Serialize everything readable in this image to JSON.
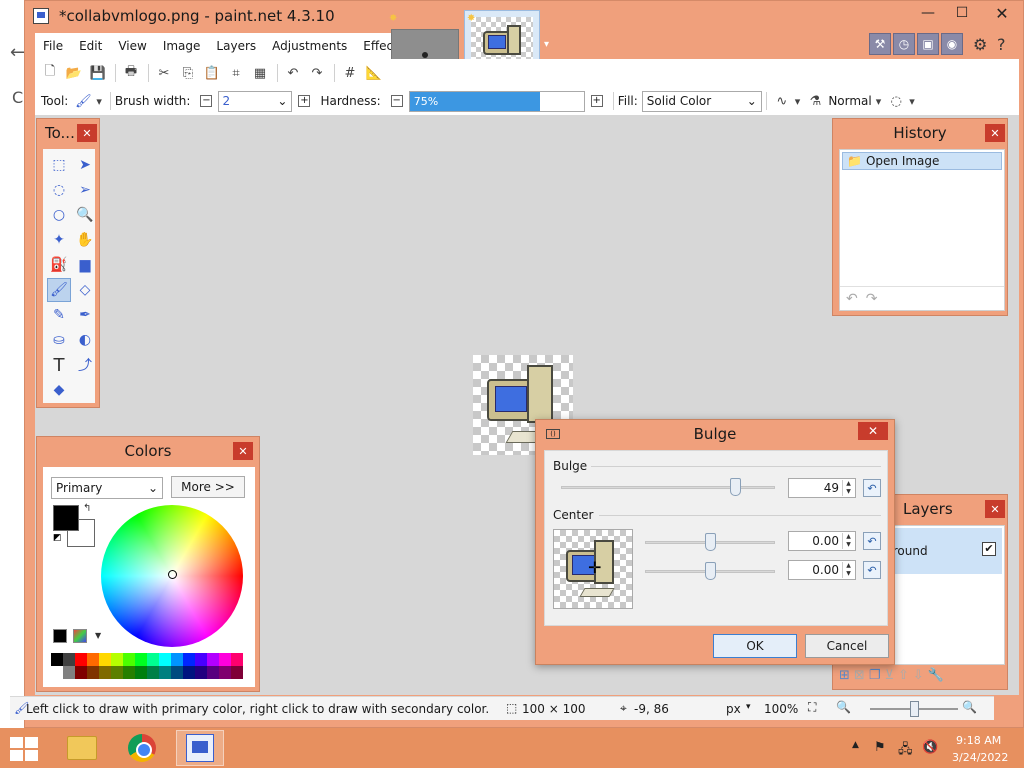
{
  "window": {
    "title": "*collabvmlogo.png - paint.net 4.3.10"
  },
  "menu": [
    "File",
    "Edit",
    "View",
    "Image",
    "Layers",
    "Adjustments",
    "Effects"
  ],
  "options": {
    "tool_label": "Tool:",
    "brush_width_label": "Brush width:",
    "brush_width_value": "2",
    "hardness_label": "Hardness:",
    "hardness_value": "75%",
    "hardness_fraction": 0.75,
    "fill_label": "Fill:",
    "fill_value": "Solid Color",
    "blend_mode": "Normal"
  },
  "tools_panel": {
    "title": "To..."
  },
  "history_panel": {
    "title": "History",
    "items": [
      "Open Image"
    ]
  },
  "colors_panel": {
    "title": "Colors",
    "mode": "Primary",
    "more_button": "More >>",
    "primary_color": "#000000",
    "secondary_color": "#ffffff"
  },
  "layers_panel": {
    "title": "Layers",
    "layer_name": "Background"
  },
  "bulge_dialog": {
    "title": "Bulge",
    "bulge_label": "Bulge",
    "bulge_value": "49",
    "center_label": "Center",
    "center_x": "0.00",
    "center_y": "0.00",
    "ok_label": "OK",
    "cancel_label": "Cancel"
  },
  "status": {
    "hint": "Left click to draw with primary color, right click to draw with secondary color.",
    "image_size": "100 × 100",
    "cursor_pos": "-9, 86",
    "units": "px",
    "zoom": "100%"
  },
  "taskbar": {
    "time": "9:18 AM",
    "date": "3/24/2022"
  },
  "colors": {
    "accent": "#f0a07c",
    "selection": "#3c97e2",
    "close": "#c83c2c"
  }
}
